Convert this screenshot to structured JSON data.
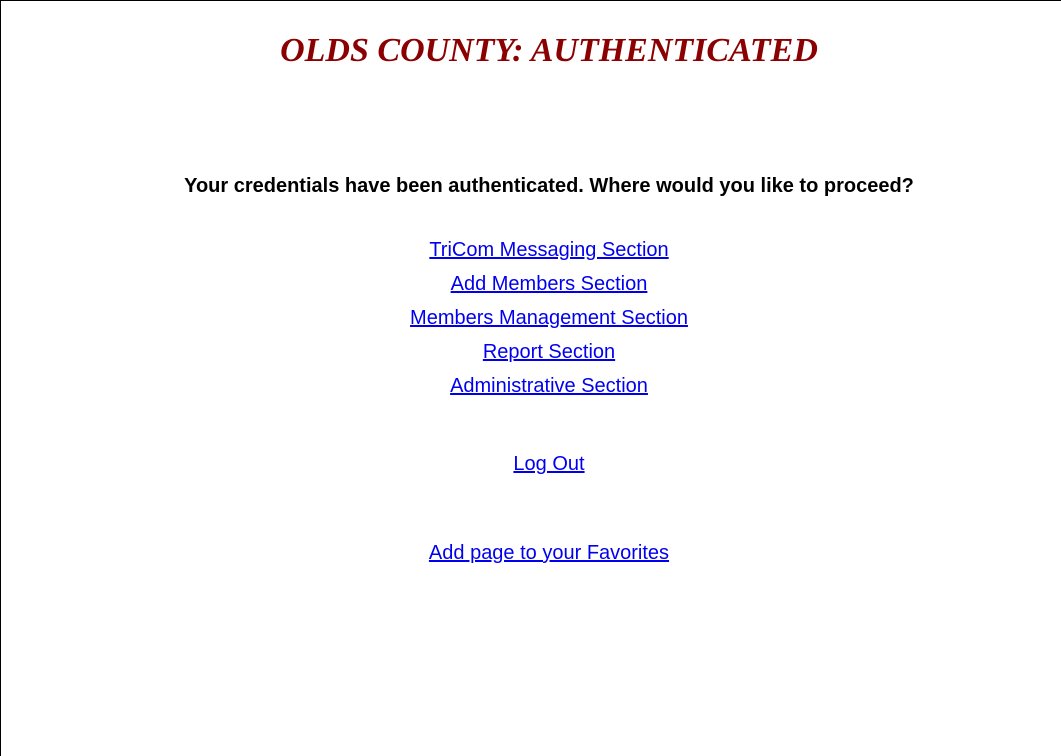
{
  "page": {
    "title": "OLDS COUNTY: AUTHENTICATED",
    "message": "Your credentials have been authenticated. Where would you like to proceed?"
  },
  "nav_links": [
    {
      "label": "TriCom Messaging Section"
    },
    {
      "label": "Add Members Section"
    },
    {
      "label": "Members Management Section"
    },
    {
      "label": "Report Section"
    },
    {
      "label": "Administrative Section"
    }
  ],
  "logout": {
    "label": "Log Out"
  },
  "favorites": {
    "label": "Add page to your Favorites"
  },
  "colors": {
    "title": "#8b0000",
    "link": "#0000ee",
    "text": "#000000",
    "background": "#ffffff"
  }
}
